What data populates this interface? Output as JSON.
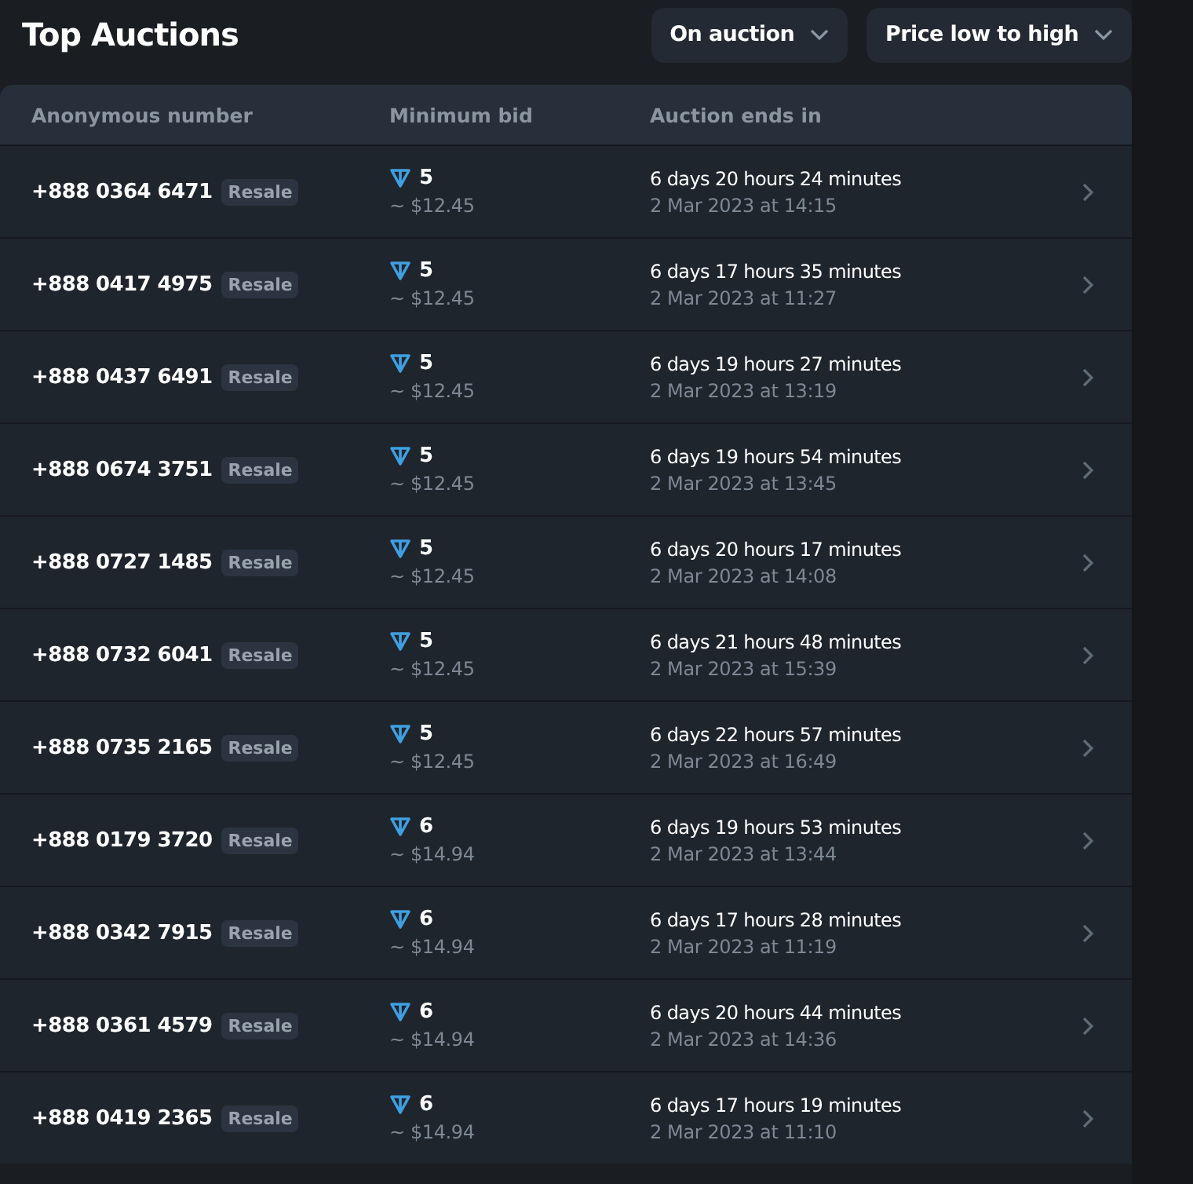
{
  "title": "Top Auctions",
  "filters": [
    {
      "label": "On auction"
    },
    {
      "label": "Price low to high"
    }
  ],
  "table": {
    "columns": [
      "Anonymous number",
      "Minimum bid",
      "Auction ends in"
    ],
    "rows": [
      {
        "number": "+888 0364 6471",
        "tag": "Resale",
        "bid": "5",
        "usd": "~ $12.45",
        "ends": "6 days 20 hours 24 minutes",
        "date": "2 Mar 2023 at 14:15"
      },
      {
        "number": "+888 0417 4975",
        "tag": "Resale",
        "bid": "5",
        "usd": "~ $12.45",
        "ends": "6 days 17 hours 35 minutes",
        "date": "2 Mar 2023 at 11:27"
      },
      {
        "number": "+888 0437 6491",
        "tag": "Resale",
        "bid": "5",
        "usd": "~ $12.45",
        "ends": "6 days 19 hours 27 minutes",
        "date": "2 Mar 2023 at 13:19"
      },
      {
        "number": "+888 0674 3751",
        "tag": "Resale",
        "bid": "5",
        "usd": "~ $12.45",
        "ends": "6 days 19 hours 54 minutes",
        "date": "2 Mar 2023 at 13:45"
      },
      {
        "number": "+888 0727 1485",
        "tag": "Resale",
        "bid": "5",
        "usd": "~ $12.45",
        "ends": "6 days 20 hours 17 minutes",
        "date": "2 Mar 2023 at 14:08"
      },
      {
        "number": "+888 0732 6041",
        "tag": "Resale",
        "bid": "5",
        "usd": "~ $12.45",
        "ends": "6 days 21 hours 48 minutes",
        "date": "2 Mar 2023 at 15:39"
      },
      {
        "number": "+888 0735 2165",
        "tag": "Resale",
        "bid": "5",
        "usd": "~ $12.45",
        "ends": "6 days 22 hours 57 minutes",
        "date": "2 Mar 2023 at 16:49"
      },
      {
        "number": "+888 0179 3720",
        "tag": "Resale",
        "bid": "6",
        "usd": "~ $14.94",
        "ends": "6 days 19 hours 53 minutes",
        "date": "2 Mar 2023 at 13:44"
      },
      {
        "number": "+888 0342 7915",
        "tag": "Resale",
        "bid": "6",
        "usd": "~ $14.94",
        "ends": "6 days 17 hours 28 minutes",
        "date": "2 Mar 2023 at 11:19"
      },
      {
        "number": "+888 0361 4579",
        "tag": "Resale",
        "bid": "6",
        "usd": "~ $14.94",
        "ends": "6 days 20 hours 44 minutes",
        "date": "2 Mar 2023 at 14:36"
      },
      {
        "number": "+888 0419 2365",
        "tag": "Resale",
        "bid": "6",
        "usd": "~ $14.94",
        "ends": "6 days 17 hours 19 minutes",
        "date": "2 Mar 2023 at 11:10"
      }
    ]
  }
}
